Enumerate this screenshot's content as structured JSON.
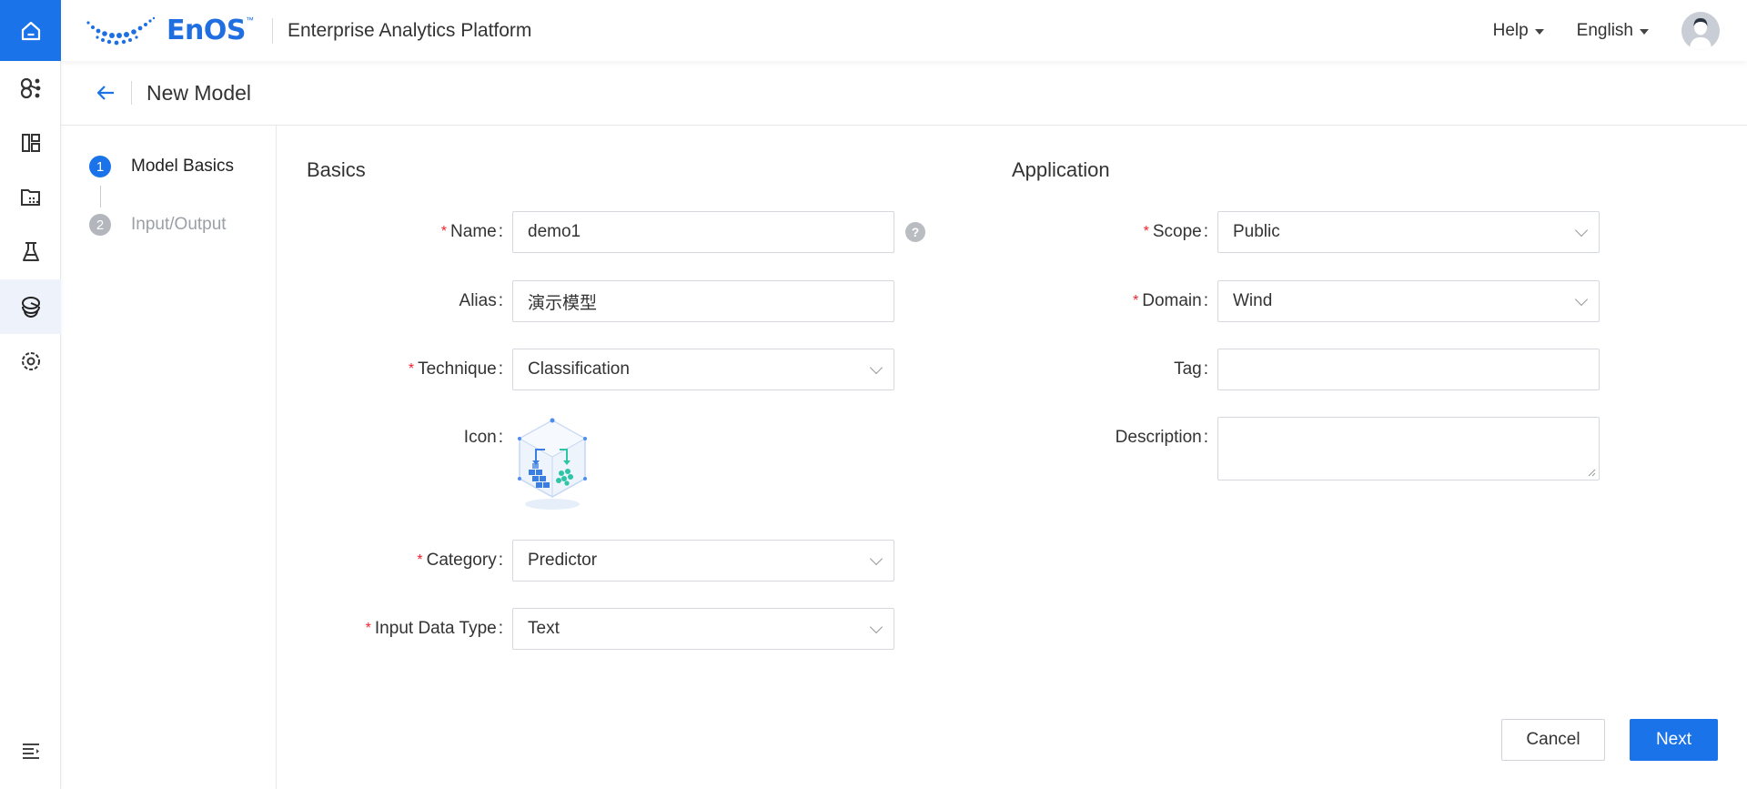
{
  "header": {
    "brand": "EnOS",
    "brand_tm": "™",
    "platform_title": "Enterprise Analytics Platform",
    "help_label": "Help",
    "language_label": "English"
  },
  "subheader": {
    "title": "New Model"
  },
  "steps": [
    {
      "number": "1",
      "label": "Model Basics",
      "active": true
    },
    {
      "number": "2",
      "label": "Input/Output",
      "active": false
    }
  ],
  "basics": {
    "title": "Basics",
    "name_label": "Name",
    "name_value": "demo1",
    "alias_label": "Alias",
    "alias_value": "演示模型",
    "technique_label": "Technique",
    "technique_value": "Classification",
    "icon_label": "Icon",
    "category_label": "Category",
    "category_value": "Predictor",
    "input_type_label": "Input Data Type",
    "input_type_value": "Text",
    "colon": ":",
    "help_glyph": "?"
  },
  "application": {
    "title": "Application",
    "scope_label": "Scope",
    "scope_value": "Public",
    "domain_label": "Domain",
    "domain_value": "Wind",
    "tag_label": "Tag",
    "tag_value": "",
    "description_label": "Description",
    "description_value": ""
  },
  "actions": {
    "cancel_label": "Cancel",
    "next_label": "Next"
  },
  "colors": {
    "accent": "#1a73e8",
    "required": "#f5222d"
  }
}
